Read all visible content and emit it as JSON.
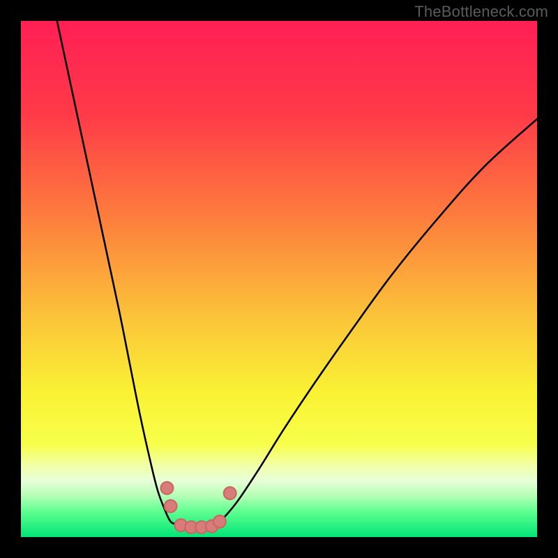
{
  "watermark": "TheBottleneck.com",
  "chart_data": {
    "type": "line",
    "title": "",
    "xlabel": "",
    "ylabel": "",
    "xlim": [
      0,
      100
    ],
    "ylim": [
      0,
      100
    ],
    "grid": false,
    "legend": false,
    "annotations": [],
    "gradient_stops": [
      {
        "offset": 0,
        "color": "#ff1f55"
      },
      {
        "offset": 18,
        "color": "#ff3a48"
      },
      {
        "offset": 40,
        "color": "#fd843c"
      },
      {
        "offset": 58,
        "color": "#fbc63a"
      },
      {
        "offset": 72,
        "color": "#faf233"
      },
      {
        "offset": 82,
        "color": "#f8ff4a"
      },
      {
        "offset": 86,
        "color": "#f2ffa6"
      },
      {
        "offset": 89,
        "color": "#e8ffd8"
      },
      {
        "offset": 92,
        "color": "#b6ffb6"
      },
      {
        "offset": 95,
        "color": "#5fff90"
      },
      {
        "offset": 100,
        "color": "#00e676"
      }
    ],
    "series": [
      {
        "name": "left-branch",
        "x": [
          7,
          10,
          13,
          16,
          19,
          21,
          23,
          25,
          26.5,
          28,
          29,
          30
        ],
        "y": [
          100,
          86,
          72,
          58,
          44,
          34,
          24,
          15,
          9,
          5,
          3,
          2.5
        ]
      },
      {
        "name": "bottom-arc",
        "x": [
          30,
          31,
          32,
          33,
          34,
          35,
          36,
          37,
          38,
          39
        ],
        "y": [
          2.5,
          2.0,
          1.8,
          1.7,
          1.7,
          1.7,
          1.8,
          2.0,
          2.5,
          3.4
        ]
      },
      {
        "name": "right-branch",
        "x": [
          39,
          42,
          46,
          51,
          57,
          64,
          72,
          81,
          90,
          100
        ],
        "y": [
          3.4,
          7,
          13,
          21,
          30,
          40,
          51,
          62,
          72,
          81
        ]
      }
    ],
    "markers": {
      "name": "salmon-dots",
      "points": [
        {
          "x": 28.3,
          "y": 9.5
        },
        {
          "x": 29.0,
          "y": 6.0
        },
        {
          "x": 31.0,
          "y": 2.3
        },
        {
          "x": 33.0,
          "y": 1.9
        },
        {
          "x": 35.0,
          "y": 1.9
        },
        {
          "x": 37.0,
          "y": 2.1
        },
        {
          "x": 38.5,
          "y": 3.0
        },
        {
          "x": 40.5,
          "y": 8.5
        }
      ],
      "radius": 1.2
    }
  }
}
